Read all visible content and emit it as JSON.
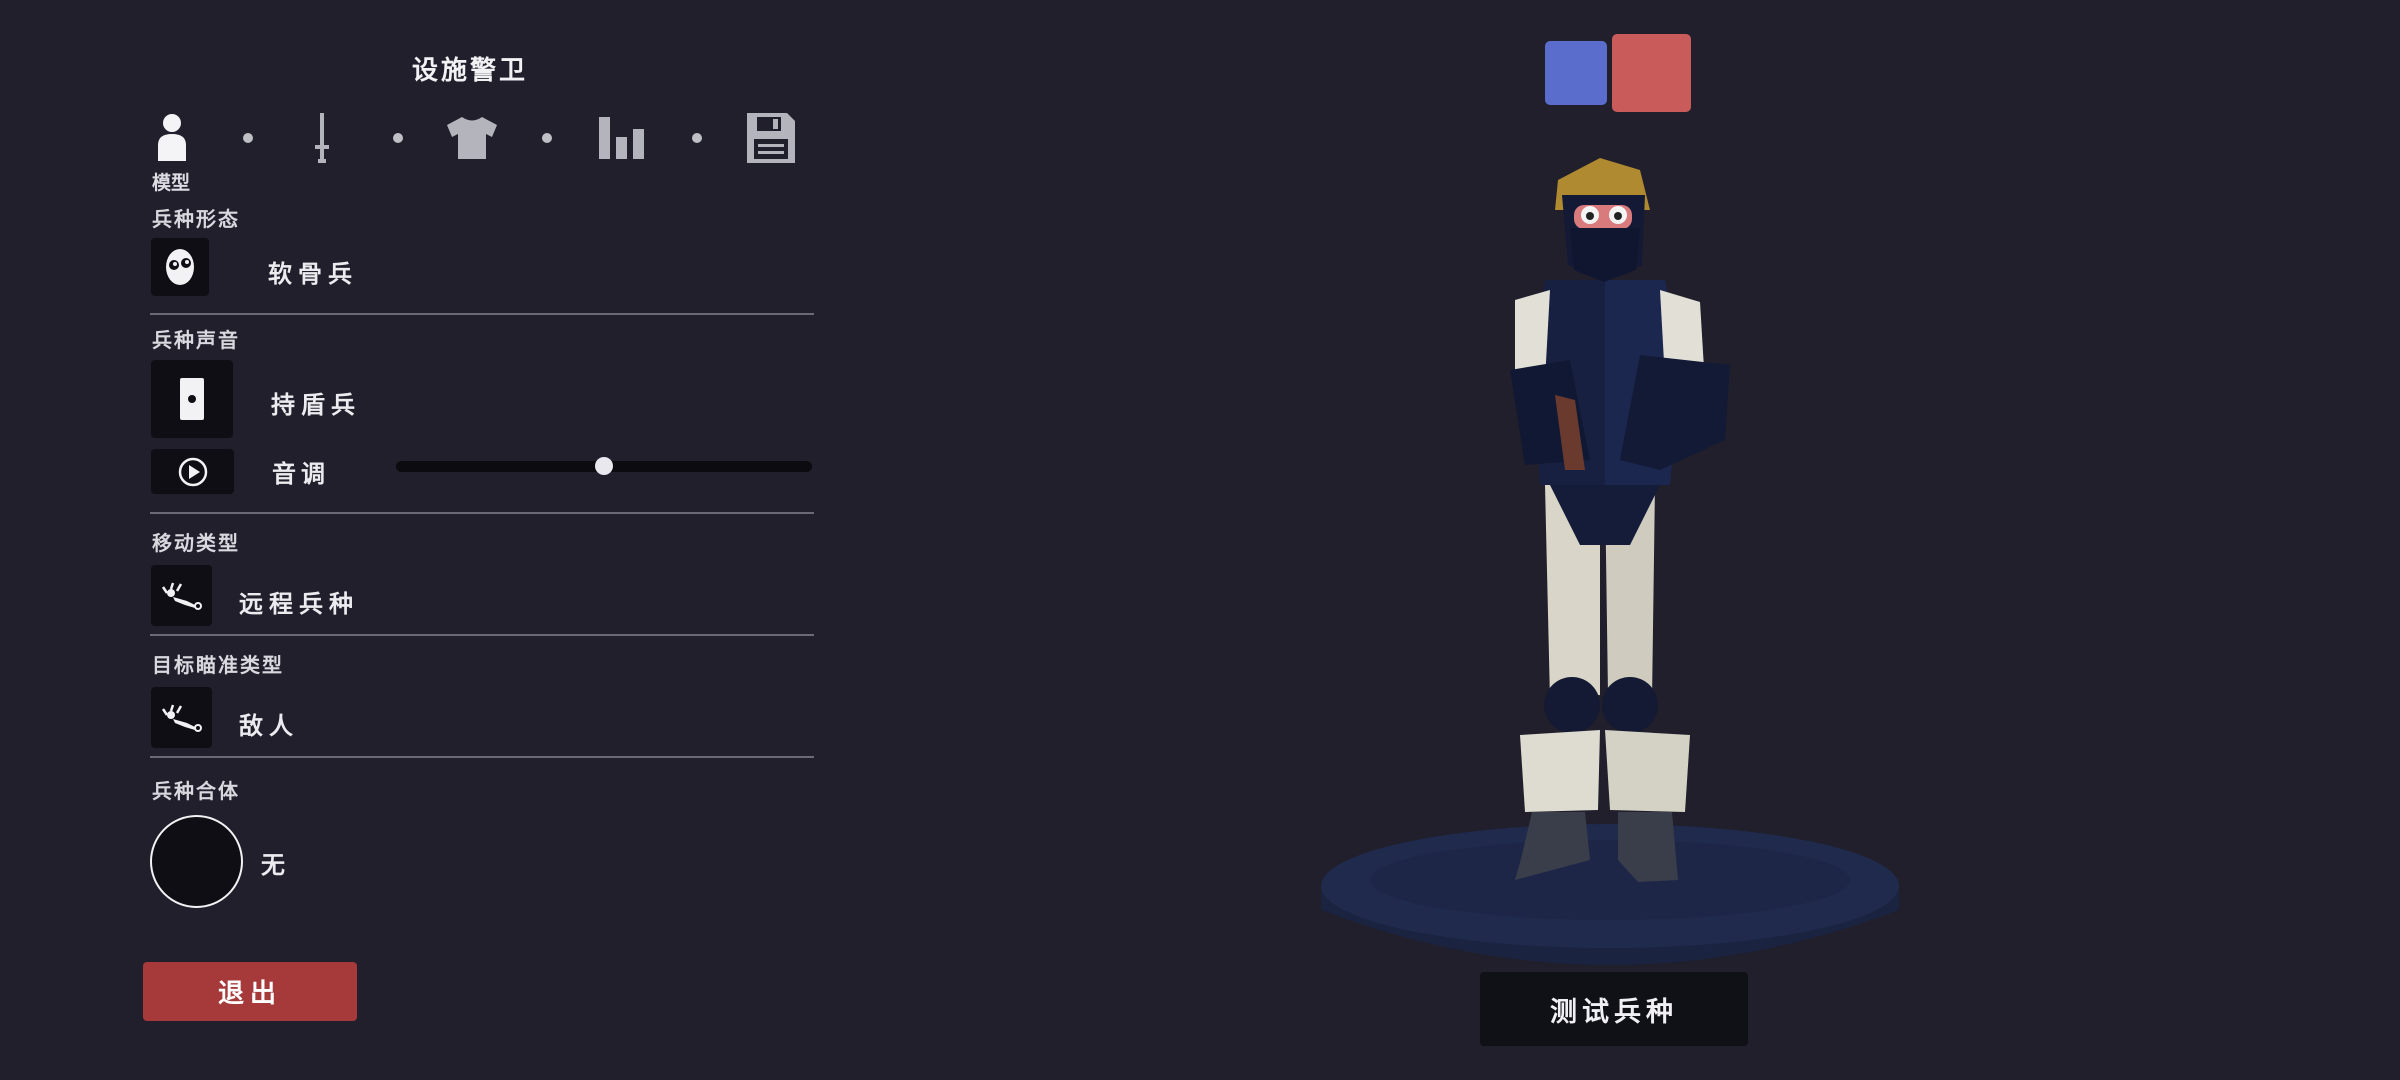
{
  "header": {
    "title": "设施警卫"
  },
  "tabs": [
    {
      "name": "model",
      "icon": "person-icon",
      "label": "模型",
      "active": true
    },
    {
      "name": "weapon",
      "icon": "sword-icon"
    },
    {
      "name": "clothing",
      "icon": "shirt-icon"
    },
    {
      "name": "stats",
      "icon": "bar-chart-icon"
    },
    {
      "name": "save",
      "icon": "floppy-disk-icon"
    }
  ],
  "sections": {
    "form": {
      "label": "兵种形态",
      "value": "软骨兵",
      "icon": "face-icon"
    },
    "voice": {
      "label": "兵种声音",
      "value": "持盾兵",
      "icon": "shield-icon",
      "pitch_label": "音调",
      "pitch": 0.5
    },
    "movement": {
      "label": "移动类型",
      "value": "远程兵种",
      "icon": "crawling-unit-icon"
    },
    "targeting": {
      "label": "目标瞄准类型",
      "value": "敌人",
      "icon": "crawling-unit-icon"
    },
    "merge": {
      "label": "兵种合体",
      "value": "无",
      "icon": "empty-circle-icon"
    }
  },
  "buttons": {
    "exit": "退出",
    "test_unit": "测试兵种"
  },
  "team_colors": [
    "#5a6ccc",
    "#c95b5b"
  ]
}
